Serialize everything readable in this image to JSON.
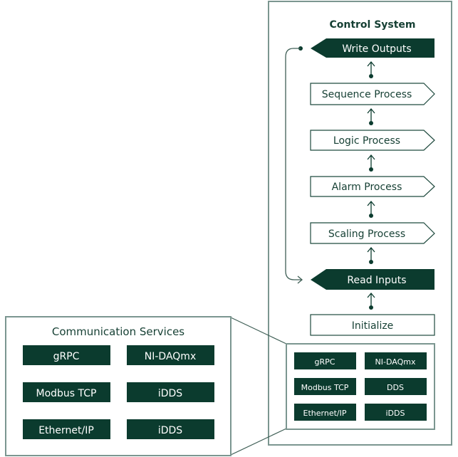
{
  "control_system": {
    "title": "Control System",
    "steps": [
      {
        "label": "Write Outputs",
        "style": "filled-left-arrow"
      },
      {
        "label": "Sequence Process",
        "style": "outline-right-arrow"
      },
      {
        "label": "Logic Process",
        "style": "outline-right-arrow"
      },
      {
        "label": "Alarm Process",
        "style": "outline-right-arrow"
      },
      {
        "label": "Scaling Process",
        "style": "outline-right-arrow"
      },
      {
        "label": "Read Inputs",
        "style": "filled-left-arrow"
      },
      {
        "label": "Initialize",
        "style": "outline-box"
      }
    ],
    "services_mini": [
      [
        "gRPC",
        "NI-DAQmx"
      ],
      [
        "Modbus TCP",
        "DDS"
      ],
      [
        "Ethernet/IP",
        "iDDS"
      ]
    ]
  },
  "communication_services": {
    "title": "Communication Services",
    "items": [
      [
        "gRPC",
        "NI-DAQmx"
      ],
      [
        "Modbus TCP",
        "iDDS"
      ],
      [
        "Ethernet/IP",
        "iDDS"
      ]
    ]
  },
  "colors": {
    "brand_dark_green": "#0b3b2e",
    "border_grey_green": "#7b9690"
  }
}
